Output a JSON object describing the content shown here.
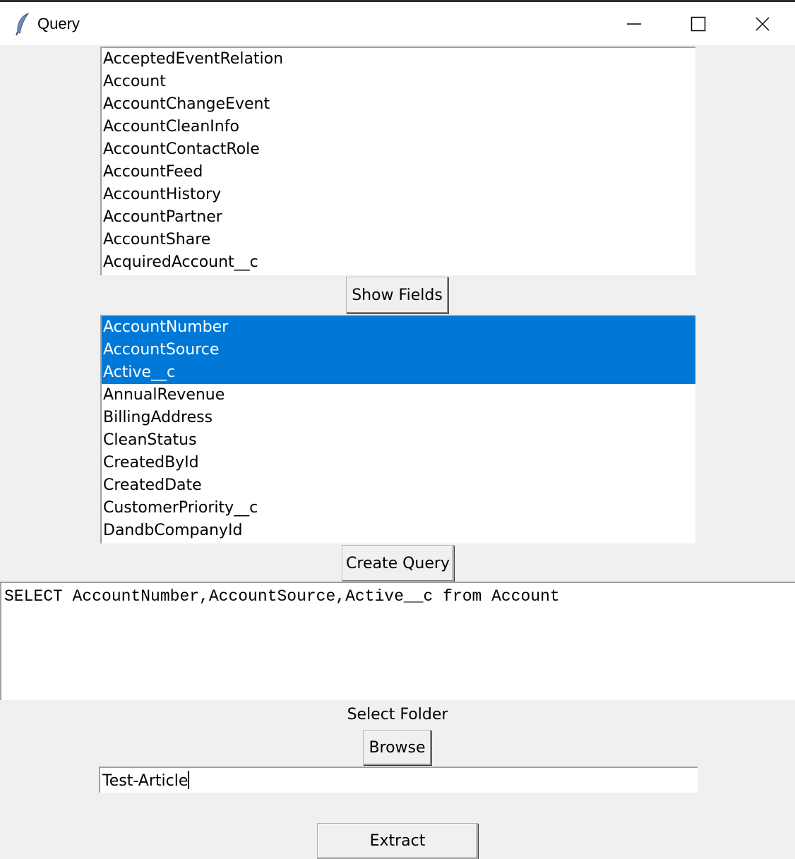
{
  "window": {
    "title": "Query",
    "icon": "feather-icon"
  },
  "objects_list": {
    "items": [
      "AcceptedEventRelation",
      "Account",
      "AccountChangeEvent",
      "AccountCleanInfo",
      "AccountContactRole",
      "AccountFeed",
      "AccountHistory",
      "AccountPartner",
      "AccountShare",
      "AcquiredAccount__c"
    ]
  },
  "buttons": {
    "show_fields": "Show Fields",
    "create_query": "Create Query",
    "browse": "Browse",
    "extract": "Extract"
  },
  "fields_list": {
    "items": [
      "AccountNumber",
      "AccountSource",
      "Active__c",
      "AnnualRevenue",
      "BillingAddress",
      "CleanStatus",
      "CreatedById",
      "CreatedDate",
      "CustomerPriority__c",
      "DandbCompanyId"
    ],
    "selected": [
      "AccountNumber",
      "AccountSource",
      "Active__c"
    ]
  },
  "query": {
    "text": "SELECT AccountNumber,AccountSource,Active__c from Account"
  },
  "folder": {
    "label": "Select Folder",
    "value": "Test-Article"
  },
  "colors": {
    "selection": "#0078d7",
    "background": "#f0f0f0"
  }
}
